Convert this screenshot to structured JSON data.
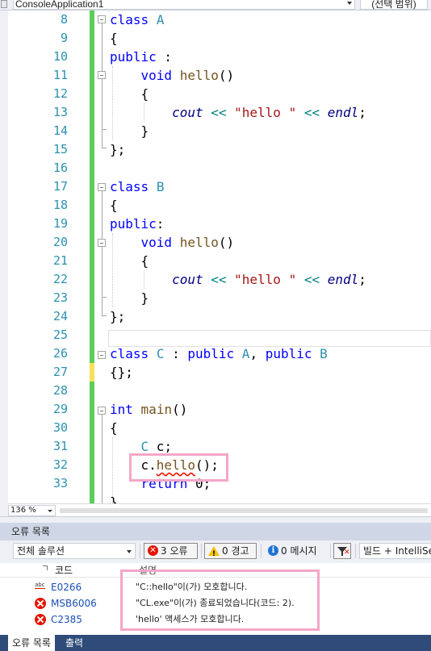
{
  "top": {
    "project": "ConsoleApplication1",
    "scope": "(선택 범위)"
  },
  "editor": {
    "line_numbers": [
      "8",
      "9",
      "10",
      "11",
      "12",
      "13",
      "14",
      "15",
      "16",
      "17",
      "18",
      "19",
      "20",
      "21",
      "22",
      "23",
      "24",
      "25",
      "26",
      "27",
      "28",
      "29",
      "30",
      "31",
      "32",
      "33"
    ],
    "zoom": "136 %"
  },
  "error_list": {
    "title": "오류 목록",
    "filter": "전체 솔루션",
    "errors_btn": "3 오류",
    "warnings_btn": "0 경고",
    "messages_btn": "0 메시지",
    "build_filter": "빌드 + IntelliSense",
    "col_code": "코드",
    "col_desc": "설명",
    "rows": [
      {
        "icon": "intellisense-error-icon",
        "code": "E0266",
        "desc": "\"C::hello\"이(가) 모호합니다."
      },
      {
        "icon": "error-icon",
        "code": "MSB6006",
        "desc": "\"CL.exe\"이(가) 종료되었습니다(코드: 2)."
      },
      {
        "icon": "error-icon",
        "code": "C2385",
        "desc": "'hello' 액세스가 모호합니다."
      }
    ]
  },
  "tabs": {
    "errors": "오류 목록",
    "output": "출력"
  },
  "colors": {
    "keyword": "#0000ff",
    "type": "#2b91af",
    "string": "#a31515",
    "highlight_box": "#f4a6c8",
    "error": "#e51400"
  }
}
